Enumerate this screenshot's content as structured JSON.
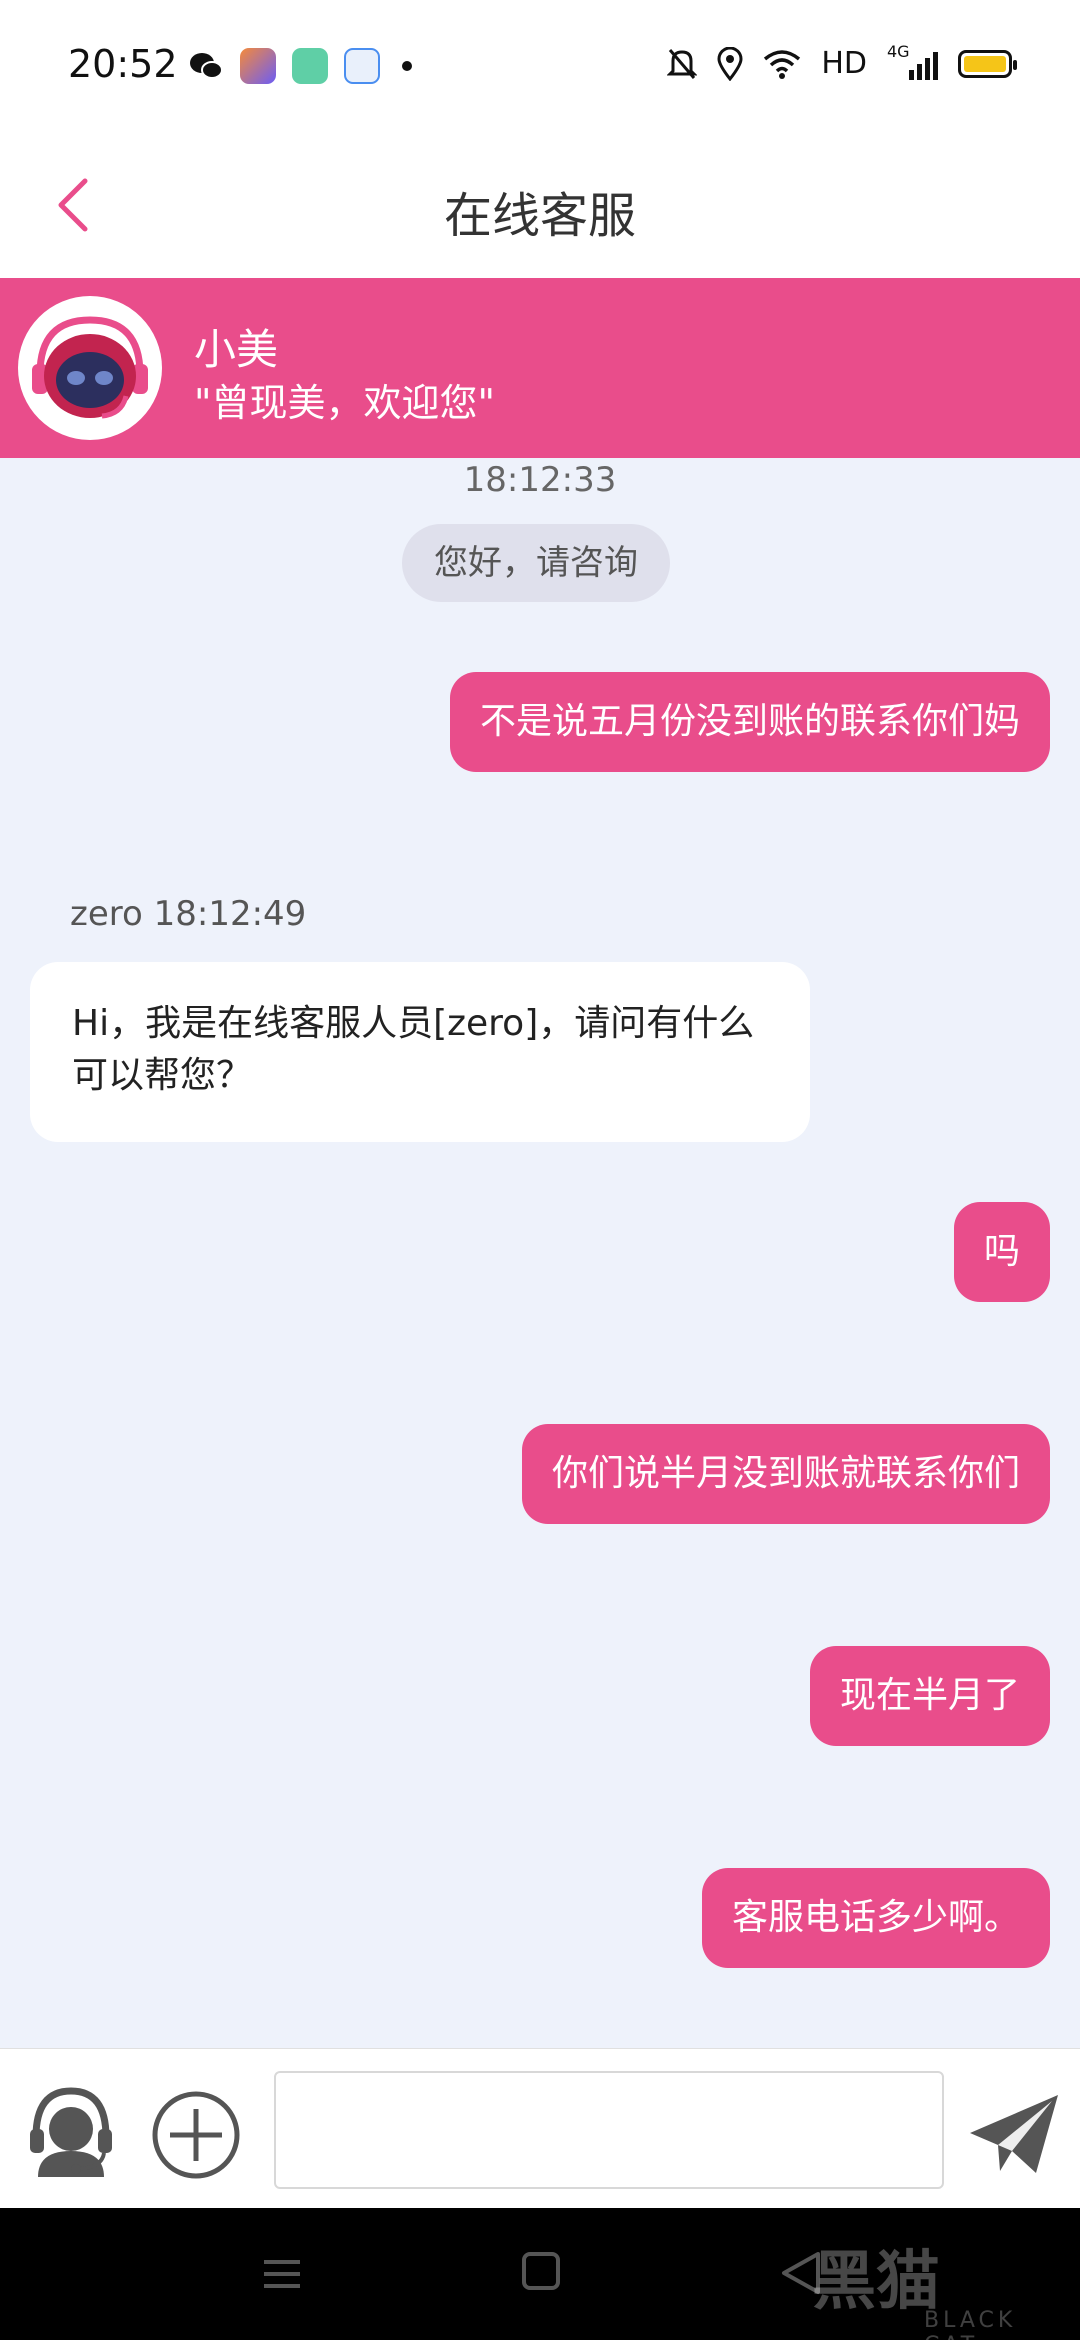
{
  "status_bar": {
    "time": "20:52",
    "network": "HD",
    "signal": "4G"
  },
  "header": {
    "title": "在线客服",
    "back_icon": "chevron-left-icon"
  },
  "agent": {
    "name": "小美",
    "slogan": "\"曾现美，欢迎您\""
  },
  "chat": {
    "session_time": "18:12:33",
    "system_greeting": "您好，请咨询",
    "messages": [
      {
        "from": "user",
        "text": "不是说五月份没到账的联系你们妈"
      },
      {
        "from": "agent",
        "sender_label": "zero 18:12:49",
        "text": "Hi，我是在线客服人员[zero]，请问有什么可以帮您？"
      },
      {
        "from": "user",
        "text": "吗"
      },
      {
        "from": "user",
        "text": "你们说半月没到账就联系你们"
      },
      {
        "from": "user",
        "text": "现在半月了"
      },
      {
        "from": "user",
        "text": "客服电话多少啊。"
      }
    ]
  },
  "input_bar": {
    "placeholder": "",
    "value": ""
  },
  "watermark": {
    "text": "黑猫",
    "sub": "BLACK CAT"
  },
  "colors": {
    "accent": "#e94d8b",
    "chat_bg": "#eef2fb"
  }
}
